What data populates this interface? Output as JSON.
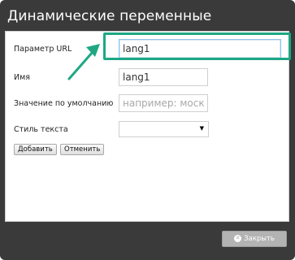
{
  "dialog": {
    "title": "Динамические переменные"
  },
  "form": {
    "url_param_label": "Параметр URL",
    "url_param_value": "lang1",
    "name_label": "Имя",
    "name_value": "lang1",
    "default_label": "Значение по умолчанию",
    "default_placeholder": "например: москва",
    "text_style_label": "Стиль текста",
    "text_style_value": "",
    "add_button": "Добавить",
    "cancel_button": "Отменить"
  },
  "footer": {
    "close_button": "Закрыть"
  },
  "annotation": {
    "highlight_color": "#1fa783"
  }
}
